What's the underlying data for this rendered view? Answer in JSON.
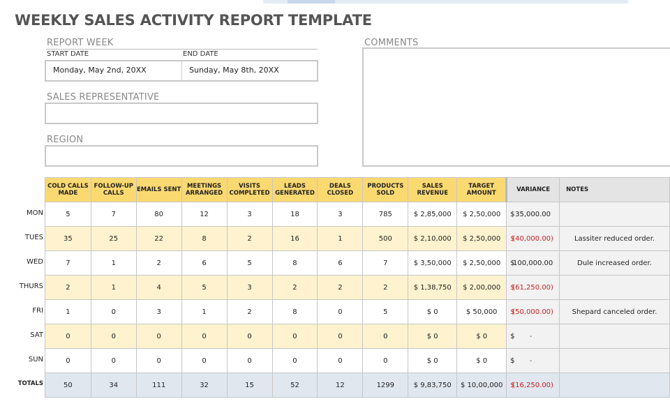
{
  "title": "WEEKLY SALES ACTIVITY REPORT TEMPLATE",
  "report_week": {
    "label": "REPORT WEEK",
    "start_label": "START DATE",
    "end_label": "END DATE",
    "start_value": "Monday, May 2nd, 20XX",
    "end_value": "Sunday, May 8th, 20XX"
  },
  "sales_rep": {
    "label": "SALES REPRESENTATIVE",
    "value": ""
  },
  "region": {
    "label": "REGION",
    "value": ""
  },
  "comments": {
    "label": "COMMENTS",
    "value": ""
  },
  "table": {
    "headers": [
      "COLD CALLS MADE",
      "FOLLOW-UP CALLS",
      "EMAILS SENT",
      "MEETINGS ARRANGED",
      "VISITS COMPLETED",
      "LEADS GENERATED",
      "DEALS CLOSED",
      "PRODUCTS SOLD",
      "SALES REVENUE",
      "TARGET AMOUNT",
      "VARIANCE",
      "NOTES"
    ],
    "rows": [
      {
        "day": "MON",
        "cells": [
          "5",
          "7",
          "80",
          "12",
          "3",
          "18",
          "3",
          "785",
          "$ 2,85,000",
          "$ 2,50,000"
        ],
        "variance": "35,000.00",
        "variance_state": "pos",
        "notes": ""
      },
      {
        "day": "TUES",
        "cells": [
          "35",
          "25",
          "22",
          "8",
          "2",
          "16",
          "1",
          "500",
          "$ 2,10,000",
          "$ 2,50,000"
        ],
        "variance": "(40,000.00)",
        "variance_state": "neg",
        "notes": "Lassiter reduced order."
      },
      {
        "day": "WED",
        "cells": [
          "7",
          "1",
          "2",
          "6",
          "5",
          "8",
          "6",
          "7",
          "$ 3,50,000",
          "$ 2,50,000"
        ],
        "variance": "100,000.00",
        "variance_state": "pos",
        "notes": "Dule increased order."
      },
      {
        "day": "THURS",
        "cells": [
          "2",
          "1",
          "4",
          "5",
          "3",
          "2",
          "2",
          "2",
          "$ 1,38,750",
          "$ 2,00,000"
        ],
        "variance": "(61,250.00)",
        "variance_state": "neg",
        "notes": ""
      },
      {
        "day": "FRI",
        "cells": [
          "1",
          "0",
          "3",
          "1",
          "2",
          "8",
          "0",
          "5",
          "$ 0",
          "$ 50,000"
        ],
        "variance": "(50,000.00)",
        "variance_state": "neg",
        "notes": "Shepard canceled order."
      },
      {
        "day": "SAT",
        "cells": [
          "0",
          "0",
          "0",
          "0",
          "0",
          "0",
          "0",
          "0",
          "$ 0",
          "$ 0"
        ],
        "variance": "-",
        "variance_state": "dim",
        "notes": ""
      },
      {
        "day": "SUN",
        "cells": [
          "0",
          "0",
          "0",
          "0",
          "0",
          "0",
          "0",
          "0",
          "$ 0",
          "$ 0"
        ],
        "variance": "-",
        "variance_state": "dim",
        "notes": ""
      }
    ],
    "totals": {
      "day": "TOTALS",
      "cells": [
        "50",
        "34",
        "111",
        "32",
        "15",
        "52",
        "12",
        "1299",
        "$ 9,83,750",
        "$ 10,00,000"
      ],
      "variance": "(16,250.00)",
      "variance_state": "neg",
      "notes": ""
    },
    "currency_symbol": "$"
  }
}
